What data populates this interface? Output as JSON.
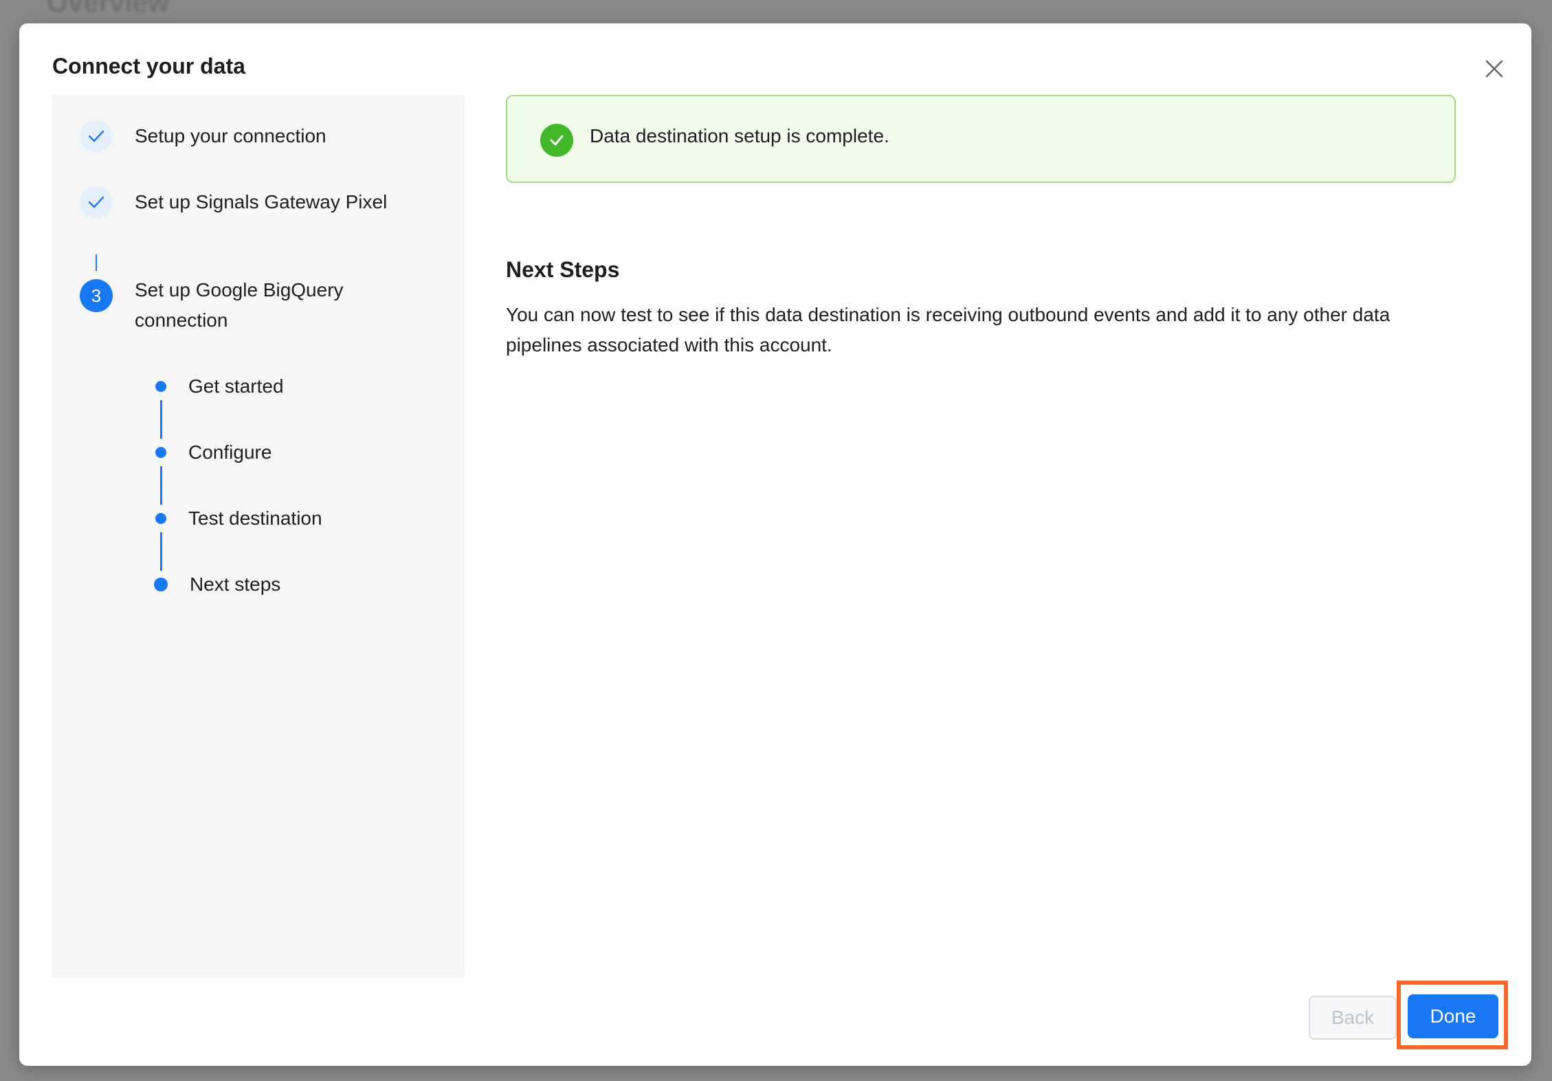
{
  "background": {
    "page_title": "Overview"
  },
  "modal": {
    "title": "Connect your data",
    "close_icon": "close-icon"
  },
  "steps": [
    {
      "label": "Setup your connection",
      "status": "done",
      "icon": "check-icon"
    },
    {
      "label": "Set up Signals Gateway Pixel",
      "status": "done",
      "icon": "check-icon"
    },
    {
      "label": "Set up Google BigQuery connection",
      "status": "active",
      "number": "3"
    }
  ],
  "substeps": [
    {
      "label": "Get started"
    },
    {
      "label": "Configure"
    },
    {
      "label": "Test destination"
    },
    {
      "label": "Next steps"
    }
  ],
  "banner": {
    "text": "Data destination setup is complete.",
    "icon": "check-circle-icon"
  },
  "content": {
    "heading": "Next Steps",
    "body": "You can now test to see if this data destination is receiving outbound events and add it to any other data pipelines associated with this account."
  },
  "footer": {
    "back_label": "Back",
    "done_label": "Done"
  },
  "colors": {
    "primary": "#1877f2",
    "success": "#42b72a",
    "highlight": "#f56a2c"
  }
}
